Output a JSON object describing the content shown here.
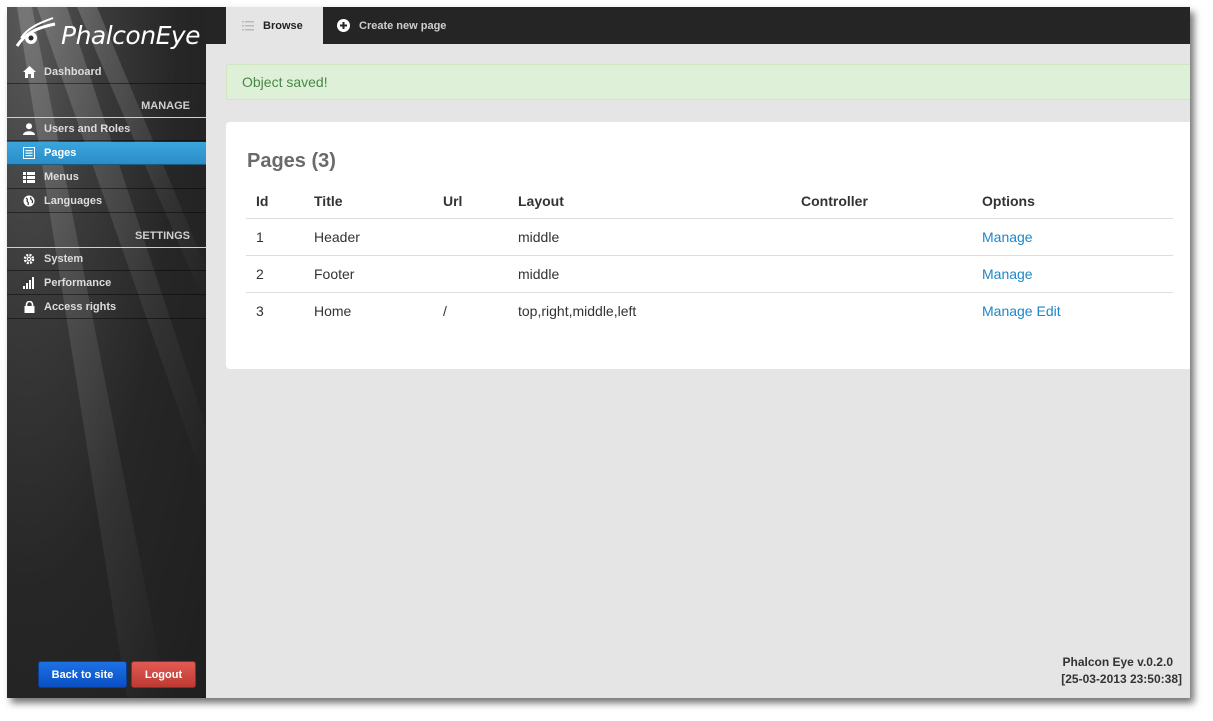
{
  "brand": {
    "name": "PhalconEye"
  },
  "sidebar": {
    "dashboard": "Dashboard",
    "manage_label": "MANAGE",
    "manage_items": [
      {
        "label": "Users and Roles",
        "icon": "user-icon"
      },
      {
        "label": "Pages",
        "icon": "pages-icon",
        "active": true
      },
      {
        "label": "Menus",
        "icon": "menu-list-icon"
      },
      {
        "label": "Languages",
        "icon": "globe-icon"
      }
    ],
    "settings_label": "SETTINGS",
    "settings_items": [
      {
        "label": "System",
        "icon": "gear-icon"
      },
      {
        "label": "Performance",
        "icon": "signal-bars-icon"
      },
      {
        "label": "Access rights",
        "icon": "lock-icon"
      }
    ],
    "back_button": "Back to site",
    "logout_button": "Logout"
  },
  "tabs": {
    "browse": "Browse",
    "create": "Create new page"
  },
  "alert": {
    "message": "Object saved!"
  },
  "panel": {
    "title": "Pages (3)",
    "columns": [
      "Id",
      "Title",
      "Url",
      "Layout",
      "Controller",
      "Options"
    ],
    "rows": [
      {
        "id": "1",
        "title": "Header",
        "url": "",
        "layout": "middle",
        "controller": "",
        "options": [
          "Manage"
        ]
      },
      {
        "id": "2",
        "title": "Footer",
        "url": "",
        "layout": "middle",
        "controller": "",
        "options": [
          "Manage"
        ]
      },
      {
        "id": "3",
        "title": "Home",
        "url": "/",
        "layout": "top,right,middle,left",
        "controller": "",
        "options": [
          "Manage",
          "Edit"
        ]
      }
    ]
  },
  "footer": {
    "version": "Phalcon Eye v.0.2.0",
    "timestamp": "[25-03-2013 23:50:38]"
  },
  "colors": {
    "active_nav": "#2b8dc8",
    "link": "#1c87c9",
    "alert_bg": "#dff0d8",
    "alert_text": "#468847",
    "back_button": "#0a4fc2",
    "logout_button": "#bd3a32"
  }
}
